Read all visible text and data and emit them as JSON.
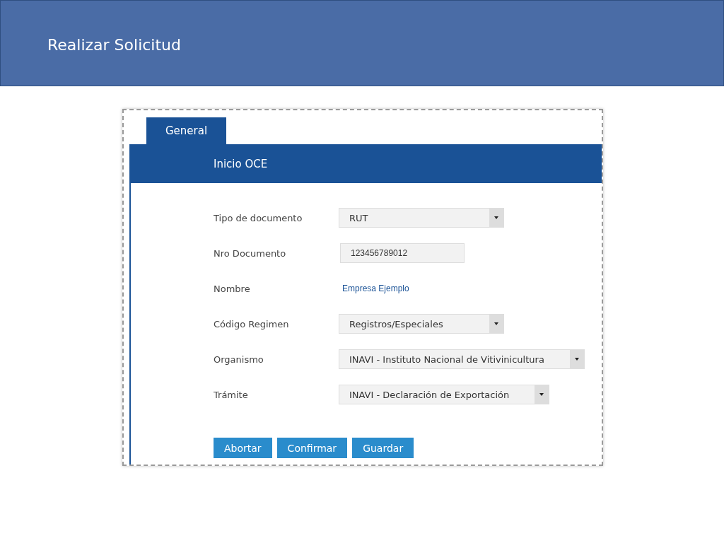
{
  "header": {
    "title": "Realizar Solicitud"
  },
  "tabs": [
    {
      "label": "General",
      "selected": true
    }
  ],
  "section": {
    "title": "Inicio OCE"
  },
  "fields": [
    {
      "kind": "select",
      "label": "Tipo de documento",
      "value": "RUT"
    },
    {
      "kind": "input",
      "label": "Nro Documento",
      "value": "123456789012"
    },
    {
      "kind": "text",
      "label": "Nombre",
      "value": "Empresa Ejemplo"
    },
    {
      "kind": "select",
      "label": "Código Regimen",
      "value": "Registros/Especiales"
    },
    {
      "kind": "select",
      "label": "Organismo",
      "value": "INAVI - Instituto Nacional de Vitivinicultura"
    },
    {
      "kind": "select",
      "label": "Trámite",
      "value": "INAVI - Declaración de Exportación"
    }
  ],
  "buttons": [
    "Abortar",
    "Confirmar",
    "Guardar"
  ]
}
